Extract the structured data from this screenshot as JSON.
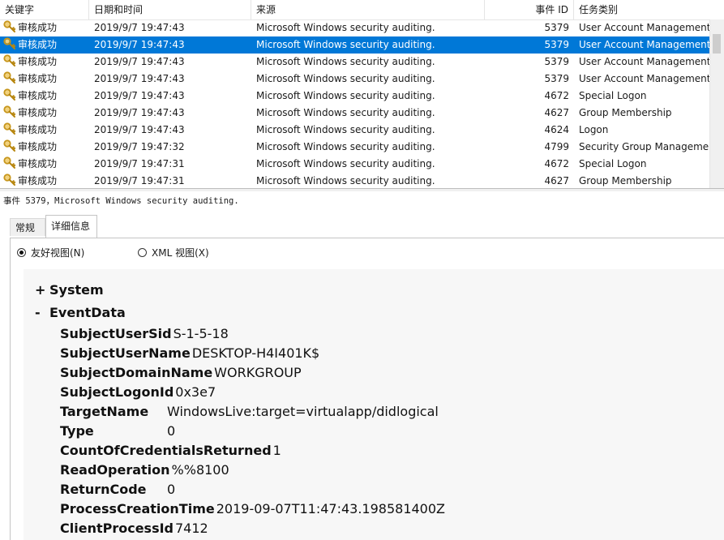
{
  "columns": {
    "keyword": "关键字",
    "datetime": "日期和时间",
    "source": "来源",
    "event_id": "事件 ID",
    "category": "任务类别"
  },
  "rows": [
    {
      "keyword": "审核成功",
      "datetime": "2019/9/7 19:47:43",
      "source": "Microsoft Windows security auditing.",
      "event_id": "5379",
      "category": "User Account Management"
    },
    {
      "keyword": "审核成功",
      "datetime": "2019/9/7 19:47:43",
      "source": "Microsoft Windows security auditing.",
      "event_id": "5379",
      "category": "User Account Management"
    },
    {
      "keyword": "审核成功",
      "datetime": "2019/9/7 19:47:43",
      "source": "Microsoft Windows security auditing.",
      "event_id": "5379",
      "category": "User Account Management"
    },
    {
      "keyword": "审核成功",
      "datetime": "2019/9/7 19:47:43",
      "source": "Microsoft Windows security auditing.",
      "event_id": "5379",
      "category": "User Account Management"
    },
    {
      "keyword": "审核成功",
      "datetime": "2019/9/7 19:47:43",
      "source": "Microsoft Windows security auditing.",
      "event_id": "4672",
      "category": "Special Logon"
    },
    {
      "keyword": "审核成功",
      "datetime": "2019/9/7 19:47:43",
      "source": "Microsoft Windows security auditing.",
      "event_id": "4627",
      "category": "Group Membership"
    },
    {
      "keyword": "审核成功",
      "datetime": "2019/9/7 19:47:43",
      "source": "Microsoft Windows security auditing.",
      "event_id": "4624",
      "category": "Logon"
    },
    {
      "keyword": "审核成功",
      "datetime": "2019/9/7 19:47:32",
      "source": "Microsoft Windows security auditing.",
      "event_id": "4799",
      "category": "Security Group Management"
    },
    {
      "keyword": "审核成功",
      "datetime": "2019/9/7 19:47:31",
      "source": "Microsoft Windows security auditing.",
      "event_id": "4672",
      "category": "Special Logon"
    },
    {
      "keyword": "审核成功",
      "datetime": "2019/9/7 19:47:31",
      "source": "Microsoft Windows security auditing.",
      "event_id": "4627",
      "category": "Group Membership"
    }
  ],
  "selected_row": 1,
  "detail": {
    "title": "事件 5379，Microsoft Windows security auditing.",
    "tabs": [
      "常规",
      "详细信息"
    ],
    "active_tab": 1,
    "views": {
      "friendly": "友好视图(N)",
      "xml": "XML 视图(X)"
    },
    "nodes": {
      "system_sign": "+",
      "system": "System",
      "eventdata_sign": "-",
      "eventdata": "EventData"
    },
    "fields": [
      {
        "name": "SubjectUserSid",
        "value": "S-1-5-18"
      },
      {
        "name": "SubjectUserName",
        "value": "DESKTOP-H4I401K$"
      },
      {
        "name": "SubjectDomainName",
        "value": "WORKGROUP"
      },
      {
        "name": "SubjectLogonId",
        "value": "0x3e7"
      },
      {
        "name": "TargetName",
        "value": "WindowsLive:target=virtualapp/didlogical"
      },
      {
        "name": "Type",
        "value": "0"
      },
      {
        "name": "CountOfCredentialsReturned",
        "value": "1"
      },
      {
        "name": "ReadOperation",
        "value": "%%8100"
      },
      {
        "name": "ReturnCode",
        "value": "0"
      },
      {
        "name": "ProcessCreationTime",
        "value": "2019-09-07T11:47:43.198581400Z"
      },
      {
        "name": "ClientProcessId",
        "value": "7412"
      }
    ]
  },
  "colors": {
    "selection": "#0078d7",
    "key_icon": "#d4a017"
  },
  "icons": {
    "row_icon": "key-icon"
  }
}
